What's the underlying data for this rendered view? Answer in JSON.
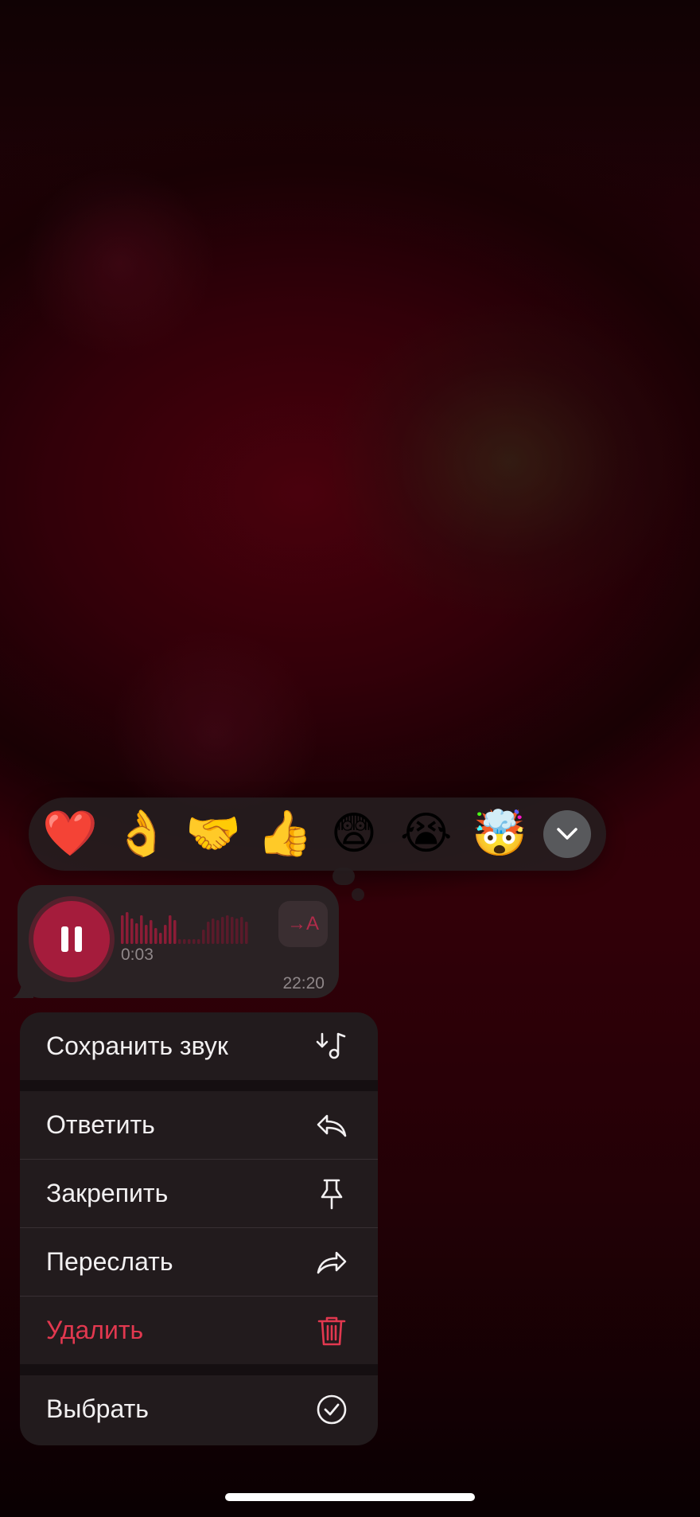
{
  "reactions": [
    {
      "emoji": "❤️",
      "icon": "red-heart"
    },
    {
      "emoji": "👌",
      "icon": "ok-hand"
    },
    {
      "emoji": "🤝",
      "icon": "handshake"
    },
    {
      "emoji": "👍",
      "icon": "thumbs-up"
    },
    {
      "emoji": "😨",
      "icon": "fearful-face"
    },
    {
      "emoji": "😭",
      "icon": "loudly-crying-face"
    },
    {
      "emoji": "🤯",
      "icon": "exploding-head"
    }
  ],
  "voice_message": {
    "duration": "0:03",
    "time": "22:20",
    "transcribe_label": "→A",
    "state_icon": "pause-icon",
    "accent_color": "#a51c3c"
  },
  "menu": {
    "items": [
      {
        "label": "Сохранить звук",
        "icon": "save-audio-icon"
      },
      {
        "label": "Ответить",
        "icon": "reply-icon"
      },
      {
        "label": "Закрепить",
        "icon": "pin-icon"
      },
      {
        "label": "Переслать",
        "icon": "forward-icon"
      },
      {
        "label": "Удалить",
        "icon": "trash-icon",
        "color": "#e2384f"
      },
      {
        "label": "Выбрать",
        "icon": "checkmark-circle-icon"
      }
    ]
  }
}
